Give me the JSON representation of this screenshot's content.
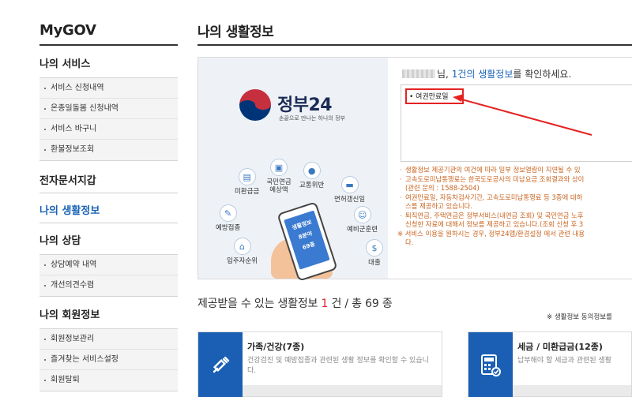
{
  "sidebar": {
    "brand": "MyGOV",
    "sections": [
      {
        "title": "나의 서비스",
        "items": [
          "서비스 신청내역",
          "온종일돌봄 신청내역",
          "서비스 바구니",
          "환불정보조회"
        ]
      },
      {
        "title": "전자문서지갑",
        "items": []
      },
      {
        "title": "나의 생활정보",
        "items": []
      },
      {
        "title": "나의 상담",
        "items": [
          "상담예약 내역",
          "개선의견수렴"
        ]
      },
      {
        "title": "나의 회원정보",
        "items": [
          "회원정보관리",
          "즐겨찾는 서비스설정",
          "회원탈퇴"
        ]
      }
    ]
  },
  "main": {
    "page_title": "나의 생활정보",
    "banner": {
      "logo_name": "정부24",
      "slogan": "손끝으로 만나는 하나의 정부",
      "services": [
        "미환급금",
        "국민연금 예상액",
        "교통위반",
        "면허갱신일",
        "예방접종",
        "예비군훈련",
        "입주자순위",
        "대출"
      ],
      "phone_text": [
        "생활정보",
        "8분야",
        "69종"
      ],
      "greeting_suffix": "님,",
      "greeting_count": "1건의 생활정보",
      "greeting_tail": "를 확인하세요.",
      "info_item": "• 여권만료일",
      "notes": [
        "생활정보 제공기관의 여건에 따라 일부 정보열람이 지연될 수 있",
        "고속도로미납통행료는 한국도로공사의 미납요금 조회결과와 상이",
        "(관련 문의 : 1588-2504)",
        "여권만료일, 자동차검사기간, 고속도로미납통행료 등 3종에 대하",
        "스를 제공하고 있습니다.",
        "퇴직연금, 주택연금은 정부서비스(내연금 조회) 및 국민연금 노후",
        "신청한 자료에 대해서 정보를 제공하고 있습니다.(조회 신청 후 3",
        "※ 서비스 이용을 원하시는 경우, 정부24앱/환경설정 에서 관련 내용",
        "다."
      ]
    },
    "provide": {
      "prefix": "제공받을 수 있는 생활정보",
      "count": "1",
      "middle": "건 / 총",
      "total": "69",
      "unit": "종"
    },
    "consent_link": "※ 생활정보 동의정보를",
    "cards": [
      {
        "title": "가족/건강(7종)",
        "desc": "건강검진 및 예방접종과 관련된 생활 정보를 확인할 수 있습니다."
      },
      {
        "title": "세금 / 미환급금(12종)",
        "desc": "납부해야 할 세금과 관련된 생활"
      }
    ]
  },
  "colors": {
    "accent_blue": "#1a63b5",
    "highlight_red": "#e52222",
    "note_orange": "#c9641f",
    "card_icon_bg": "#1a5fb4"
  }
}
